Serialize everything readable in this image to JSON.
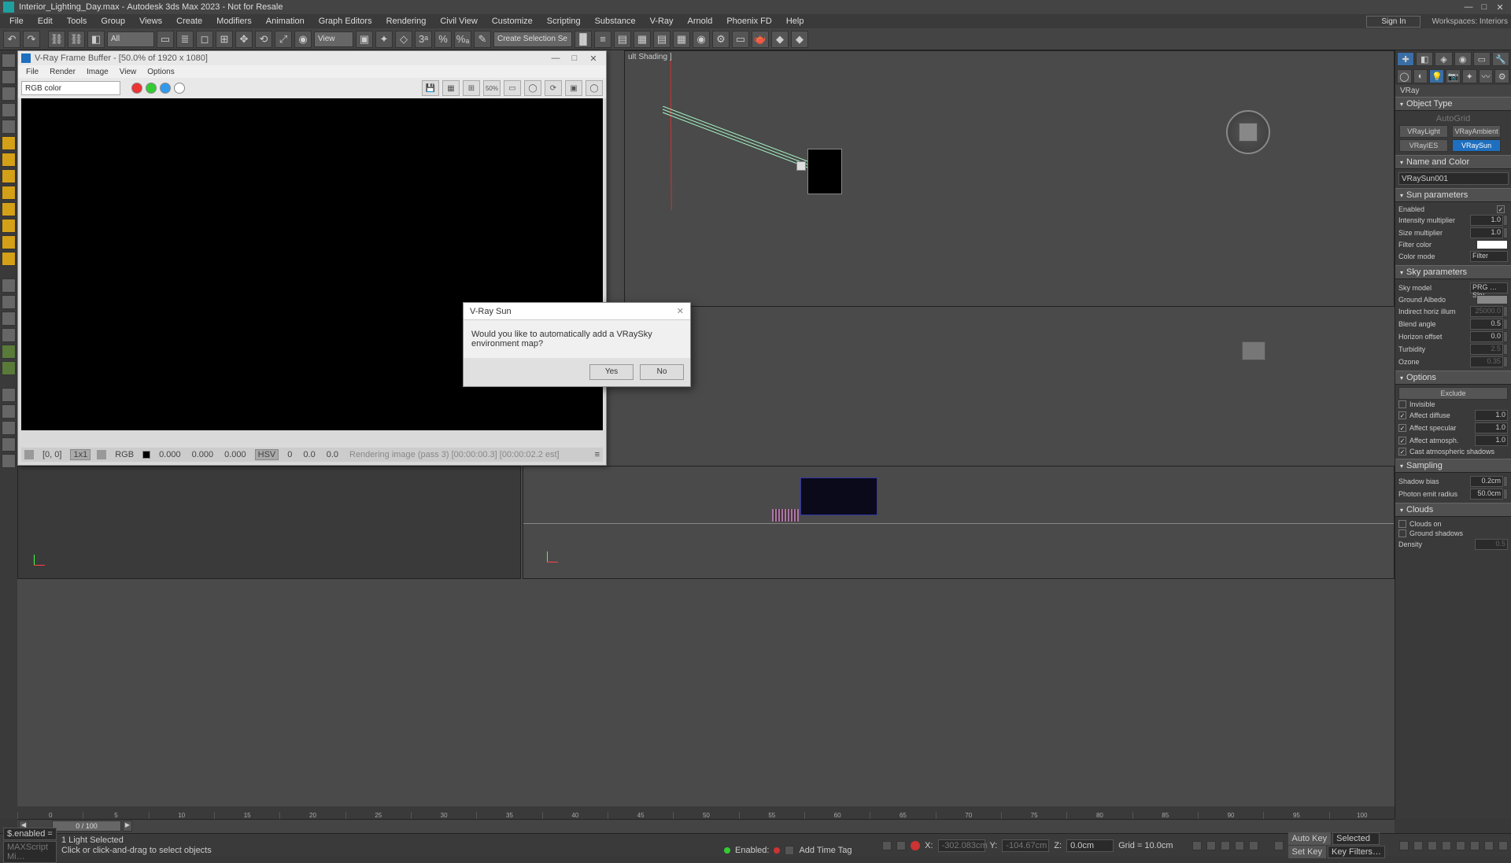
{
  "titlebar": {
    "doc": "Interior_Lighting_Day.max",
    "app": "Autodesk 3ds Max 2023 - Not for Resale"
  },
  "menu": [
    "File",
    "Edit",
    "Tools",
    "Group",
    "Views",
    "Create",
    "Modifiers",
    "Animation",
    "Graph Editors",
    "Rendering",
    "Civil View",
    "Customize",
    "Scripting",
    "Substance",
    "V-Ray",
    "Arnold",
    "Phoenix FD",
    "Help"
  ],
  "signin": "Sign In",
  "workspaces_label": "Workspaces: Interiors",
  "toolbar": {
    "all": "All",
    "view": "View",
    "selset": "Create Selection Se"
  },
  "vfb": {
    "title": "V-Ray Frame Buffer - [50.0% of 1920 x 1080]",
    "menu": [
      "File",
      "Render",
      "Image",
      "View",
      "Options"
    ],
    "channel": "RGB color",
    "status_coord": "[0, 0]",
    "status_layer": "1x1",
    "status_rgb_label": "RGB",
    "status_rgb": [
      "0.000",
      "0.000",
      "0.000"
    ],
    "status_hsv_label": "HSV",
    "status_hsv": [
      "0",
      "0.0",
      "0.0"
    ],
    "status_render": "Rendering image (pass 3) [00:00:00.3] [00:00:02.2 est]"
  },
  "dialog": {
    "title": "V-Ray Sun",
    "message": "Would you like to automatically add a VRaySky environment map?",
    "yes": "Yes",
    "no": "No"
  },
  "cmd": {
    "category": "VRay",
    "object_type_hdr": "Object Type",
    "autogrid": "AutoGrid",
    "buttons": [
      "VRayLight",
      "VRayAmbient",
      "VRayIES",
      "VRaySun"
    ],
    "name_hdr": "Name and Color",
    "name": "VRaySun001",
    "sunparams_hdr": "Sun parameters",
    "enabled": "Enabled",
    "intensity_mul": "Intensity multiplier",
    "intensity_mul_v": "1.0",
    "size_mul": "Size multiplier",
    "size_mul_v": "1.0",
    "filter_color": "Filter color",
    "color_mode": "Color mode",
    "color_mode_v": "Filter",
    "skyparams_hdr": "Sky parameters",
    "sky_model": "Sky model",
    "sky_model_v": "PRG … Sky",
    "ground_albedo": "Ground Albedo",
    "indirect_horiz": "Indirect horiz illum",
    "indirect_horiz_v": "25000.0",
    "blend_angle": "Blend angle",
    "blend_angle_v": "0.5",
    "horizon_offset": "Horizon offset",
    "horizon_offset_v": "0.0",
    "turbidity": "Turbidity",
    "turbidity_v": "2.5",
    "ozone": "Ozone",
    "ozone_v": "0.35",
    "options_hdr": "Options",
    "exclude": "Exclude",
    "invisible": "Invisible",
    "affect_diffuse": "Affect diffuse",
    "affect_diffuse_v": "1.0",
    "affect_specular": "Affect specular",
    "affect_specular_v": "1.0",
    "affect_atmosph": "Affect atmosph.",
    "affect_atmosph_v": "1.0",
    "cast_atmos": "Cast atmospheric shadows",
    "sampling_hdr": "Sampling",
    "shadow_bias": "Shadow bias",
    "shadow_bias_v": "0.2cm",
    "photon_emit": "Photon emit radius",
    "photon_emit_v": "50.0cm",
    "clouds_hdr": "Clouds",
    "clouds_on": "Clouds on",
    "ground_shadows": "Ground shadows",
    "density": "Density",
    "density_v": "0.5"
  },
  "viewport": {
    "label_top": "ult Shading ]"
  },
  "timeline": {
    "pos": "0 / 100",
    "ticks": [
      "0",
      "5",
      "10",
      "15",
      "20",
      "25",
      "30",
      "35",
      "40",
      "45",
      "50",
      "55",
      "60",
      "65",
      "70",
      "75",
      "80",
      "85",
      "90",
      "95",
      "100"
    ]
  },
  "status": {
    "script1": "$.enabled =",
    "script2": "MAXScript Mi…",
    "sel": "1 Light Selected",
    "prompt": "Click or click-and-drag to select objects",
    "x_label": "X:",
    "x": "-302.083cm",
    "y_label": "Y:",
    "y": "-104.67cm",
    "z_label": "Z:",
    "z": "0.0cm",
    "grid": "Grid = 10.0cm",
    "enabled_label": "Enabled:",
    "addtime": "Add Time Tag",
    "autokey": "Auto Key",
    "selected": "Selected",
    "setkey": "Set Key",
    "keyfilters": "Key Filters…"
  }
}
